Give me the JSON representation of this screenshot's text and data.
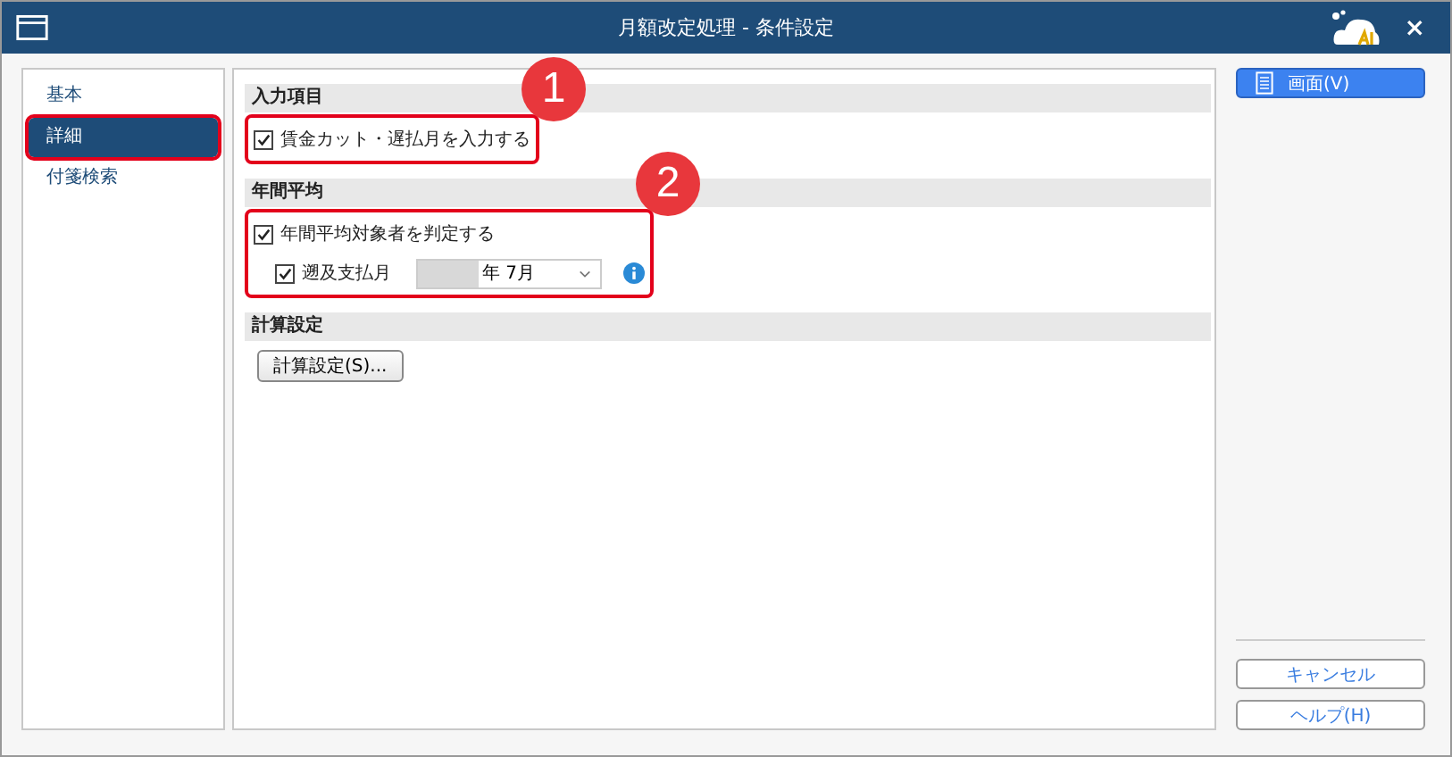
{
  "window": {
    "title": "月額改定処理 - 条件設定",
    "close": "×"
  },
  "sidebar": {
    "items": [
      {
        "label": "基本",
        "selected": false,
        "highlight": false
      },
      {
        "label": "詳細",
        "selected": true,
        "highlight": true
      },
      {
        "label": "付箋検索",
        "selected": false,
        "highlight": false
      }
    ]
  },
  "sections": [
    {
      "title": "入力項目",
      "highlight": true,
      "callout": "1",
      "items": [
        {
          "kind": "checkbox",
          "label": "賃金カット・遅払月を入力する",
          "checked": true
        }
      ]
    },
    {
      "title": "年間平均",
      "highlight": true,
      "callout": "2",
      "items": [
        {
          "kind": "checkbox",
          "label": "年間平均対象者を判定する",
          "checked": true
        },
        {
          "kind": "checkbox_combo",
          "label": "遡及支払月",
          "checked": true,
          "value": "年 7月"
        }
      ]
    },
    {
      "title": "計算設定",
      "highlight": false,
      "items": [
        {
          "kind": "button",
          "label": "計算設定(S)..."
        }
      ]
    }
  ],
  "actions": {
    "top": [
      {
        "label": "画面(V)",
        "kind": "primary"
      }
    ],
    "bottom": [
      {
        "label": "キャンセル"
      },
      {
        "label": "ヘルプ(H)"
      }
    ]
  }
}
